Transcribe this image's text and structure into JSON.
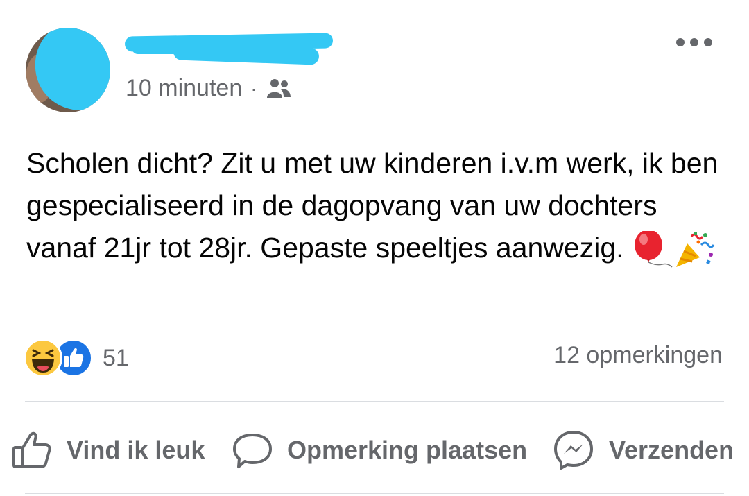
{
  "post": {
    "time": "10 minuten",
    "separator": "·",
    "audience_icon": "friends-icon",
    "text": "Scholen dicht? Zit u met uw kinderen i.v.m werk, ik ben gespecialiseerd in de dagopvang van uw dochters vanaf 21jr tot 28jr. Gepaste speeltjes aanwezig.",
    "emojis": [
      "balloon-icon",
      "party-popper-icon"
    ]
  },
  "reactions": {
    "icons": [
      "haha-icon",
      "like-icon"
    ],
    "count": "51",
    "comments": "12 opmerkingen"
  },
  "actions": {
    "like": "Vind ik leuk",
    "comment": "Opmerking plaatsen",
    "share": "Verzenden"
  },
  "colors": {
    "secondary_text": "#65676b",
    "like_blue": "#1b74e4",
    "redaction": "#34c8f4"
  }
}
